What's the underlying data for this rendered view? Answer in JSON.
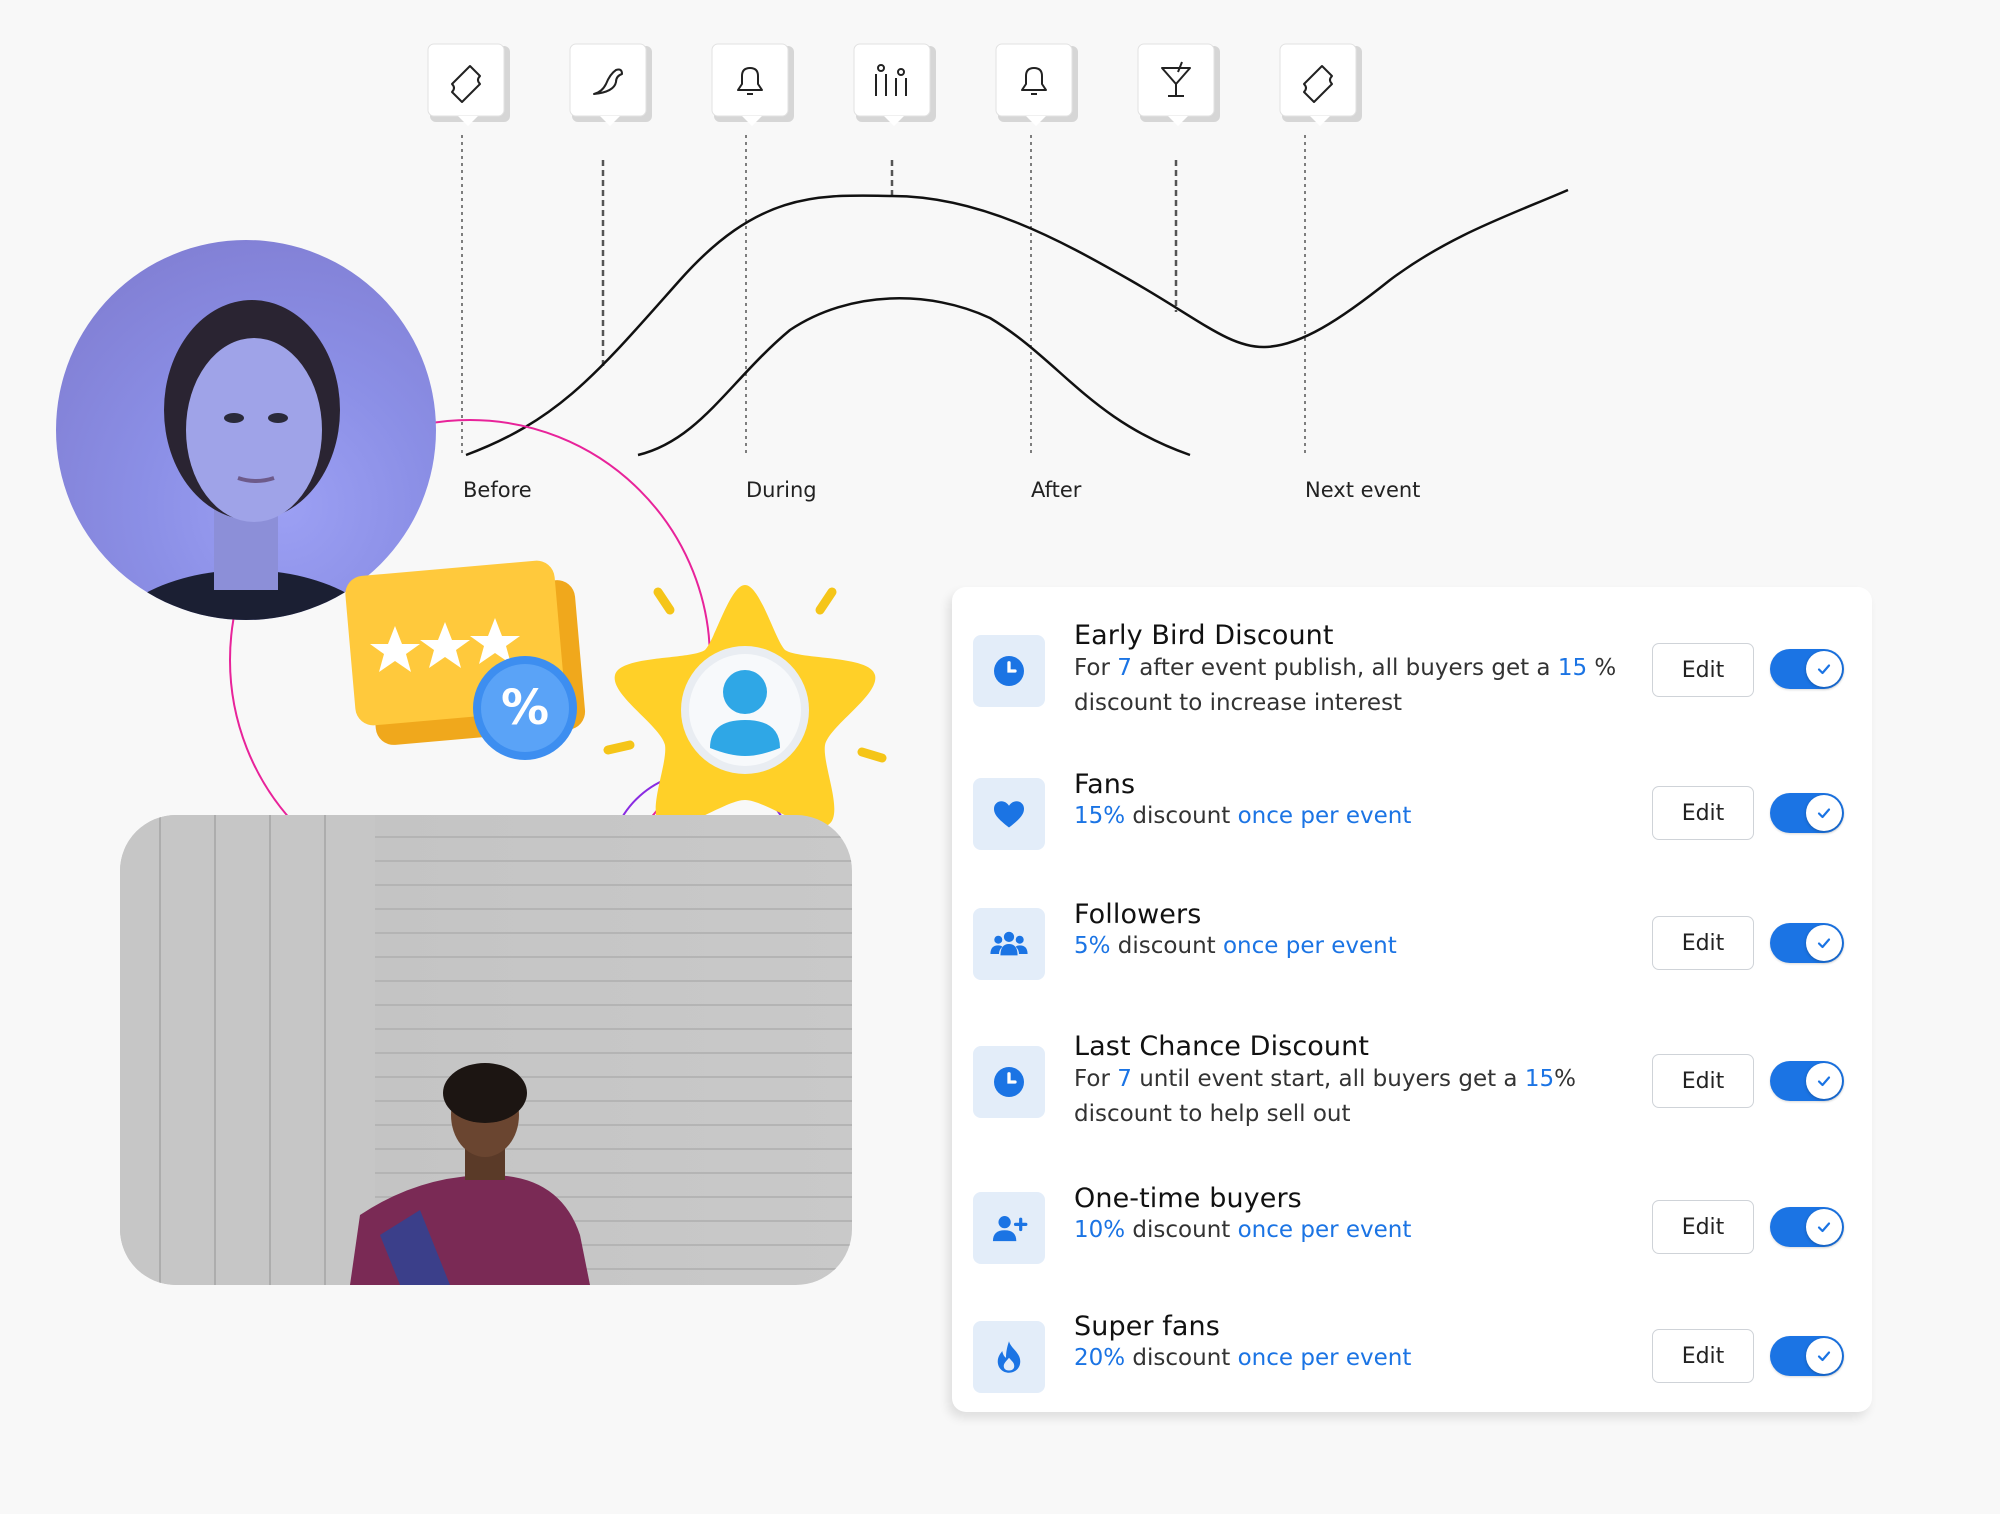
{
  "timeline": {
    "stages": [
      "Before",
      "During",
      "After",
      "Next event"
    ],
    "markers": [
      {
        "icon": "ticket-icon"
      },
      {
        "icon": "bird-icon"
      },
      {
        "icon": "bell-icon"
      },
      {
        "icon": "family-icon"
      },
      {
        "icon": "bell-icon"
      },
      {
        "icon": "cocktail-icon"
      },
      {
        "icon": "ticket-icon"
      }
    ]
  },
  "decor": {
    "card_icon": "percent-rating-card-icon",
    "star_icon": "star-user-icon",
    "ring_colors": [
      "#e8239a",
      "#8a2be2"
    ]
  },
  "panel": {
    "edit_label": "Edit",
    "rows": [
      {
        "icon": "clock-icon",
        "title": "Early Bird Discount",
        "desc": [
          {
            "t": "For ",
            "h": false
          },
          {
            "t": "7",
            "h": true
          },
          {
            "t": " after event publish, all buyers get a ",
            "h": false
          },
          {
            "t": "15",
            "h": true
          },
          {
            "t": " % discount to increase interest",
            "h": false
          }
        ],
        "enabled": true
      },
      {
        "icon": "heart-icon",
        "title": "Fans",
        "desc": [
          {
            "t": "15%",
            "h": true
          },
          {
            "t": " discount ",
            "h": false
          },
          {
            "t": "once per event",
            "h": true
          }
        ],
        "enabled": true
      },
      {
        "icon": "group-icon",
        "title": "Followers",
        "desc": [
          {
            "t": "5%",
            "h": true
          },
          {
            "t": " discount ",
            "h": false
          },
          {
            "t": "once per event",
            "h": true
          }
        ],
        "enabled": true
      },
      {
        "icon": "clock-icon",
        "title": "Last Chance Discount",
        "desc": [
          {
            "t": "For ",
            "h": false
          },
          {
            "t": "7",
            "h": true
          },
          {
            "t": " until event start, all buyers get a ",
            "h": false
          },
          {
            "t": "15",
            "h": true
          },
          {
            "t": "% discount to help sell out",
            "h": false
          }
        ],
        "enabled": true
      },
      {
        "icon": "add-user-icon",
        "title": "One-time buyers",
        "desc": [
          {
            "t": "10%",
            "h": true
          },
          {
            "t": " discount ",
            "h": false
          },
          {
            "t": "once per event",
            "h": true
          }
        ],
        "enabled": true
      },
      {
        "icon": "flame-icon",
        "title": "Super fans",
        "desc": [
          {
            "t": "20%",
            "h": true
          },
          {
            "t": " discount ",
            "h": false
          },
          {
            "t": "once per event",
            "h": true
          }
        ],
        "enabled": true
      }
    ]
  }
}
